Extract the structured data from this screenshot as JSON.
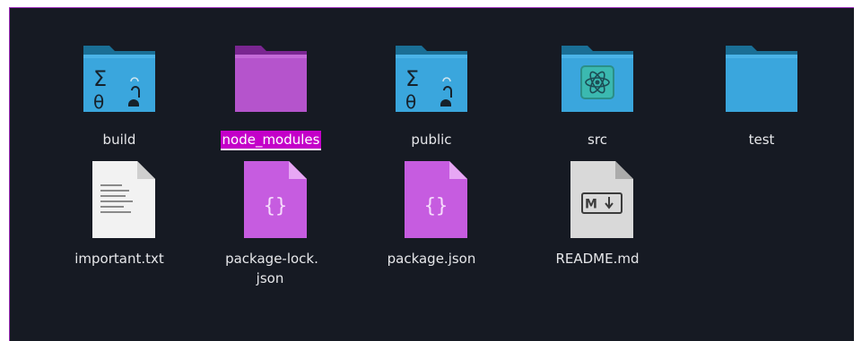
{
  "theme": {
    "background": "#161a23",
    "frame_accent": "#9b2bb8",
    "folder_blue": "#3aa6dd",
    "folder_purple": "#b554cc",
    "selection": "#c400c9",
    "label_text": "#e6e7ea"
  },
  "files": [
    {
      "label": "build",
      "icon": "build-folder-icon",
      "selected": false
    },
    {
      "label": "node_modules",
      "icon": "purple-folder-icon",
      "selected": true
    },
    {
      "label": "public",
      "icon": "build-folder-icon",
      "selected": false
    },
    {
      "label": "src",
      "icon": "source-folder-icon",
      "selected": false
    },
    {
      "label": "test",
      "icon": "blue-folder-icon",
      "selected": false
    },
    {
      "label": "important.txt",
      "icon": "text-file-icon",
      "selected": false
    },
    {
      "label": "package-lock.\njson",
      "icon": "json-file-icon",
      "selected": false
    },
    {
      "label": "package.json",
      "icon": "json-file-icon",
      "selected": false
    },
    {
      "label": "README.md",
      "icon": "markdown-file-icon",
      "selected": false
    }
  ]
}
